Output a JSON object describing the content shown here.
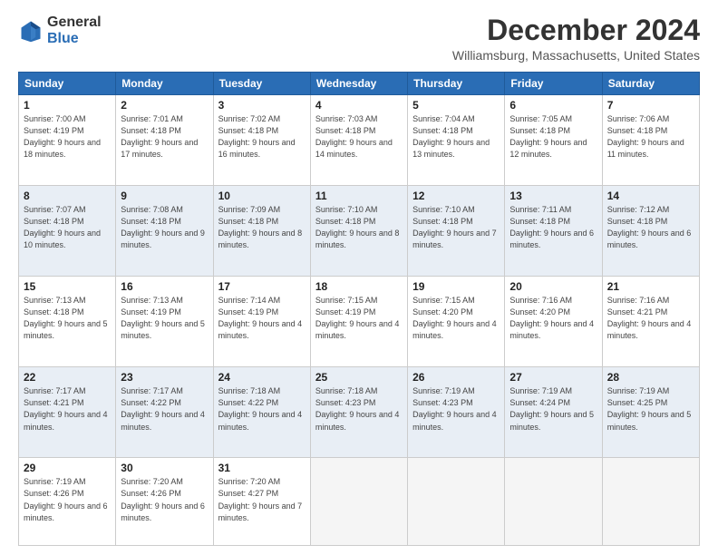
{
  "header": {
    "logo_general": "General",
    "logo_blue": "Blue",
    "month_title": "December 2024",
    "location": "Williamsburg, Massachusetts, United States"
  },
  "days_of_week": [
    "Sunday",
    "Monday",
    "Tuesday",
    "Wednesday",
    "Thursday",
    "Friday",
    "Saturday"
  ],
  "weeks": [
    [
      {
        "day": 1,
        "sunrise": "7:00 AM",
        "sunset": "4:19 PM",
        "daylight": "9 hours and 18 minutes."
      },
      {
        "day": 2,
        "sunrise": "7:01 AM",
        "sunset": "4:18 PM",
        "daylight": "9 hours and 17 minutes."
      },
      {
        "day": 3,
        "sunrise": "7:02 AM",
        "sunset": "4:18 PM",
        "daylight": "9 hours and 16 minutes."
      },
      {
        "day": 4,
        "sunrise": "7:03 AM",
        "sunset": "4:18 PM",
        "daylight": "9 hours and 14 minutes."
      },
      {
        "day": 5,
        "sunrise": "7:04 AM",
        "sunset": "4:18 PM",
        "daylight": "9 hours and 13 minutes."
      },
      {
        "day": 6,
        "sunrise": "7:05 AM",
        "sunset": "4:18 PM",
        "daylight": "9 hours and 12 minutes."
      },
      {
        "day": 7,
        "sunrise": "7:06 AM",
        "sunset": "4:18 PM",
        "daylight": "9 hours and 11 minutes."
      }
    ],
    [
      {
        "day": 8,
        "sunrise": "7:07 AM",
        "sunset": "4:18 PM",
        "daylight": "9 hours and 10 minutes."
      },
      {
        "day": 9,
        "sunrise": "7:08 AM",
        "sunset": "4:18 PM",
        "daylight": "9 hours and 9 minutes."
      },
      {
        "day": 10,
        "sunrise": "7:09 AM",
        "sunset": "4:18 PM",
        "daylight": "9 hours and 8 minutes."
      },
      {
        "day": 11,
        "sunrise": "7:10 AM",
        "sunset": "4:18 PM",
        "daylight": "9 hours and 8 minutes."
      },
      {
        "day": 12,
        "sunrise": "7:10 AM",
        "sunset": "4:18 PM",
        "daylight": "9 hours and 7 minutes."
      },
      {
        "day": 13,
        "sunrise": "7:11 AM",
        "sunset": "4:18 PM",
        "daylight": "9 hours and 6 minutes."
      },
      {
        "day": 14,
        "sunrise": "7:12 AM",
        "sunset": "4:18 PM",
        "daylight": "9 hours and 6 minutes."
      }
    ],
    [
      {
        "day": 15,
        "sunrise": "7:13 AM",
        "sunset": "4:18 PM",
        "daylight": "9 hours and 5 minutes."
      },
      {
        "day": 16,
        "sunrise": "7:13 AM",
        "sunset": "4:19 PM",
        "daylight": "9 hours and 5 minutes."
      },
      {
        "day": 17,
        "sunrise": "7:14 AM",
        "sunset": "4:19 PM",
        "daylight": "9 hours and 4 minutes."
      },
      {
        "day": 18,
        "sunrise": "7:15 AM",
        "sunset": "4:19 PM",
        "daylight": "9 hours and 4 minutes."
      },
      {
        "day": 19,
        "sunrise": "7:15 AM",
        "sunset": "4:20 PM",
        "daylight": "9 hours and 4 minutes."
      },
      {
        "day": 20,
        "sunrise": "7:16 AM",
        "sunset": "4:20 PM",
        "daylight": "9 hours and 4 minutes."
      },
      {
        "day": 21,
        "sunrise": "7:16 AM",
        "sunset": "4:21 PM",
        "daylight": "9 hours and 4 minutes."
      }
    ],
    [
      {
        "day": 22,
        "sunrise": "7:17 AM",
        "sunset": "4:21 PM",
        "daylight": "9 hours and 4 minutes."
      },
      {
        "day": 23,
        "sunrise": "7:17 AM",
        "sunset": "4:22 PM",
        "daylight": "9 hours and 4 minutes."
      },
      {
        "day": 24,
        "sunrise": "7:18 AM",
        "sunset": "4:22 PM",
        "daylight": "9 hours and 4 minutes."
      },
      {
        "day": 25,
        "sunrise": "7:18 AM",
        "sunset": "4:23 PM",
        "daylight": "9 hours and 4 minutes."
      },
      {
        "day": 26,
        "sunrise": "7:19 AM",
        "sunset": "4:23 PM",
        "daylight": "9 hours and 4 minutes."
      },
      {
        "day": 27,
        "sunrise": "7:19 AM",
        "sunset": "4:24 PM",
        "daylight": "9 hours and 5 minutes."
      },
      {
        "day": 28,
        "sunrise": "7:19 AM",
        "sunset": "4:25 PM",
        "daylight": "9 hours and 5 minutes."
      }
    ],
    [
      {
        "day": 29,
        "sunrise": "7:19 AM",
        "sunset": "4:26 PM",
        "daylight": "9 hours and 6 minutes."
      },
      {
        "day": 30,
        "sunrise": "7:20 AM",
        "sunset": "4:26 PM",
        "daylight": "9 hours and 6 minutes."
      },
      {
        "day": 31,
        "sunrise": "7:20 AM",
        "sunset": "4:27 PM",
        "daylight": "9 hours and 7 minutes."
      },
      null,
      null,
      null,
      null
    ]
  ]
}
